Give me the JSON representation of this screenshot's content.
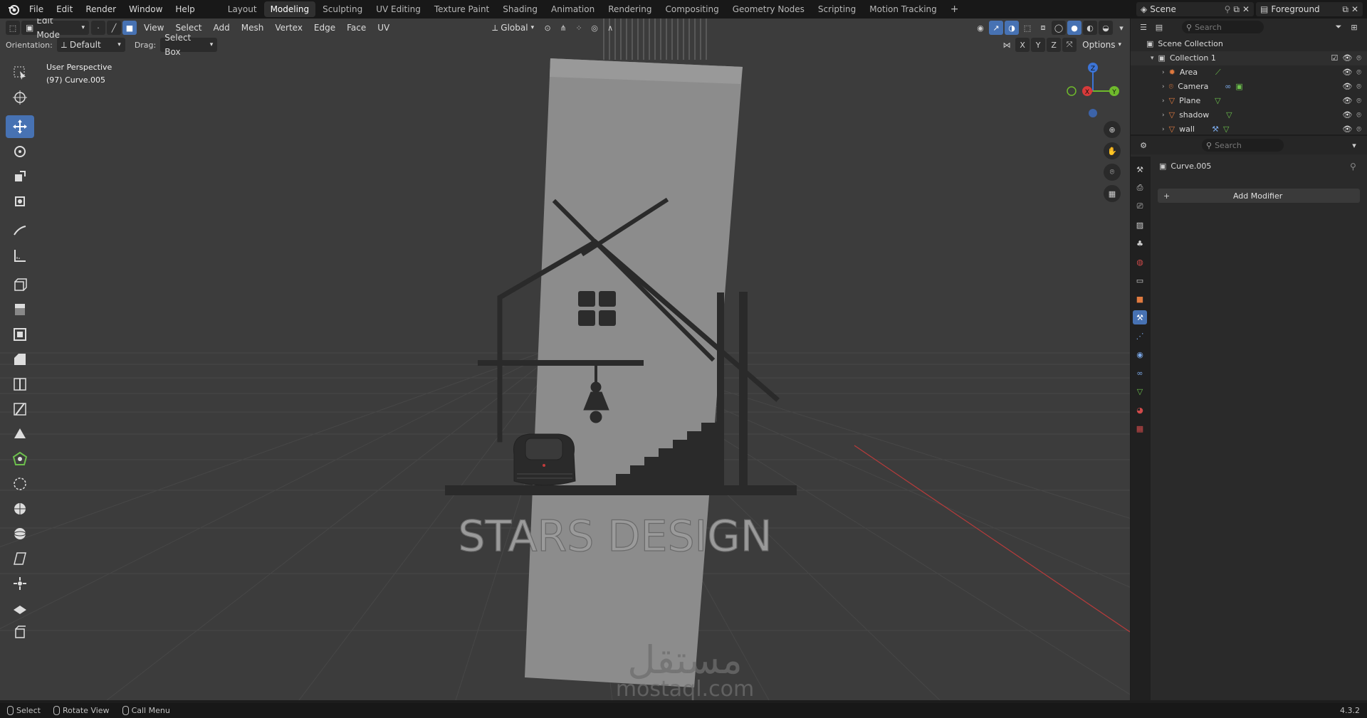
{
  "menu": [
    "File",
    "Edit",
    "Render",
    "Window",
    "Help"
  ],
  "workspaces": [
    "Layout",
    "Modeling",
    "Sculpting",
    "UV Editing",
    "Texture Paint",
    "Shading",
    "Animation",
    "Rendering",
    "Compositing",
    "Geometry Nodes",
    "Scripting",
    "Motion Tracking"
  ],
  "active_workspace": "Modeling",
  "scene_name": "Scene",
  "view_layer": "Foreground",
  "viewport": {
    "mode": "Edit Mode",
    "menus": [
      "View",
      "Select",
      "Add",
      "Mesh",
      "Vertex",
      "Edge",
      "Face",
      "UV"
    ],
    "transform_orientation": "Global",
    "orientation_label": "Orientation:",
    "orientation_value": "Default",
    "drag_label": "Drag:",
    "drag_value": "Select Box",
    "options_label": "Options",
    "axes": [
      "X",
      "Y",
      "Z"
    ],
    "overlay_line1": "User Perspective",
    "overlay_line2": "(97) Curve.005",
    "scene_text": "STARS DESIGN",
    "watermark_arabic": "مستقل",
    "watermark_latin": "mostaql.com"
  },
  "gizmo": {
    "z": "Z",
    "y": "Y",
    "x": "X"
  },
  "outliner": {
    "search_placeholder": "Search",
    "scene_collection": "Scene Collection",
    "collection": "Collection 1",
    "items": [
      {
        "name": "Area",
        "icon": "light-icon"
      },
      {
        "name": "Camera",
        "icon": "camera-icon"
      },
      {
        "name": "Plane",
        "icon": "mesh-icon"
      },
      {
        "name": "shadow",
        "icon": "mesh-icon"
      },
      {
        "name": "wall",
        "icon": "mesh-icon"
      }
    ]
  },
  "properties": {
    "search_placeholder": "Search",
    "object_name": "Curve.005",
    "add_modifier": "Add Modifier"
  },
  "statusbar": {
    "select": "Select",
    "rotate": "Rotate View",
    "call_menu": "Call Menu",
    "version": "4.3.2"
  },
  "colors": {
    "accent": "#4772b3",
    "x_axis": "#d83a3a",
    "y_axis": "#6fba2c",
    "z_axis": "#3c74d6",
    "object_orange": "#e07a3f",
    "data_green": "#6dc04d"
  }
}
